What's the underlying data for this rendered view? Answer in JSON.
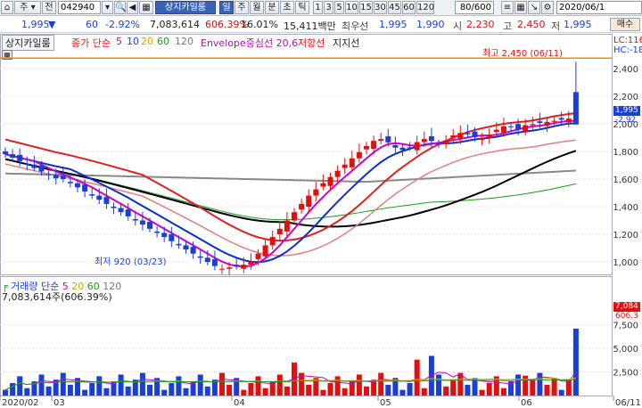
{
  "toolbar": {
    "market_label": "주",
    "prev_label": "전",
    "code": "042940",
    "name_tag": "상지카일룸",
    "period_day": "일",
    "period_week": "주",
    "period_month": "월",
    "period_min": "분",
    "period_sec": "초",
    "period_tick": "틱",
    "intervals": [
      "1",
      "3",
      "5",
      "10",
      "15",
      "30",
      "45",
      "60",
      "120"
    ],
    "count": "80/600",
    "date_value": "2020/06/1"
  },
  "quote": {
    "price": "1,995",
    "down_arrow": "▼",
    "change": "60",
    "change_pct": "-2.92%",
    "volume": "7,083,614",
    "vol_ratio": "606.39%",
    "turnover": "16.01%",
    "amount": "15,411백만",
    "best_label": "최우선",
    "ask": "1,995",
    "bid": "1,990",
    "open_label": "시",
    "open": "2,230",
    "high_label": "고",
    "high": "2,450",
    "low_label": "저",
    "low": "1,995",
    "buy_label": "매수"
  },
  "legend": {
    "stock_name": "상지카일룸",
    "ma_label": "종가 단순",
    "ma_periods": [
      "5",
      "10",
      "20",
      "60",
      "120"
    ],
    "envelope": "Envelope중심선 20,6",
    "resistance": "저항선",
    "support": "지지선"
  },
  "price_panel": {
    "max_annot": "최고 2,450 (06/11)",
    "min_annot": "최저 920 (03/23)",
    "lc": "LC:116",
    "hc": "HC:-18",
    "current_tag": "1,995",
    "change_tag": "-2.92",
    "y_ticks": [
      "2,400",
      "2,200",
      "2,000",
      "1,800",
      "1,600",
      "1,400",
      "1,200",
      "1,000"
    ]
  },
  "volume_panel": {
    "ma_label": "거래량 단순",
    "ma_periods": [
      "5",
      "20",
      "60",
      "120"
    ],
    "value_line": "7,083,614주(606.39%)",
    "y_ticks": [
      "7,500",
      "5,000",
      "2,500"
    ],
    "tag_value": "7,084",
    "tag_pct": "606.3"
  },
  "x_axis": {
    "labels": [
      "2020/02",
      "03",
      "04",
      "05",
      "06",
      "06/11"
    ]
  },
  "colors": {
    "up": "#e01010",
    "down": "#1b3fd6",
    "ma5": "#d000d0",
    "ma10": "#0a2fd0",
    "ma20": "#e02020",
    "ma60": "#000000",
    "ma120": "#888888",
    "resistance": "#f28c00"
  },
  "chart_data": {
    "type": "candlestick",
    "price_axis_range": [
      900,
      2450
    ],
    "series_notes": "Daily candlestick with moving averages (5,10,20,60,120), envelope and resistance line at 2,450",
    "high": {
      "value": 2450,
      "date": "06/11"
    },
    "low": {
      "value": 920,
      "date": "03/23"
    },
    "last_close": 1995
  }
}
